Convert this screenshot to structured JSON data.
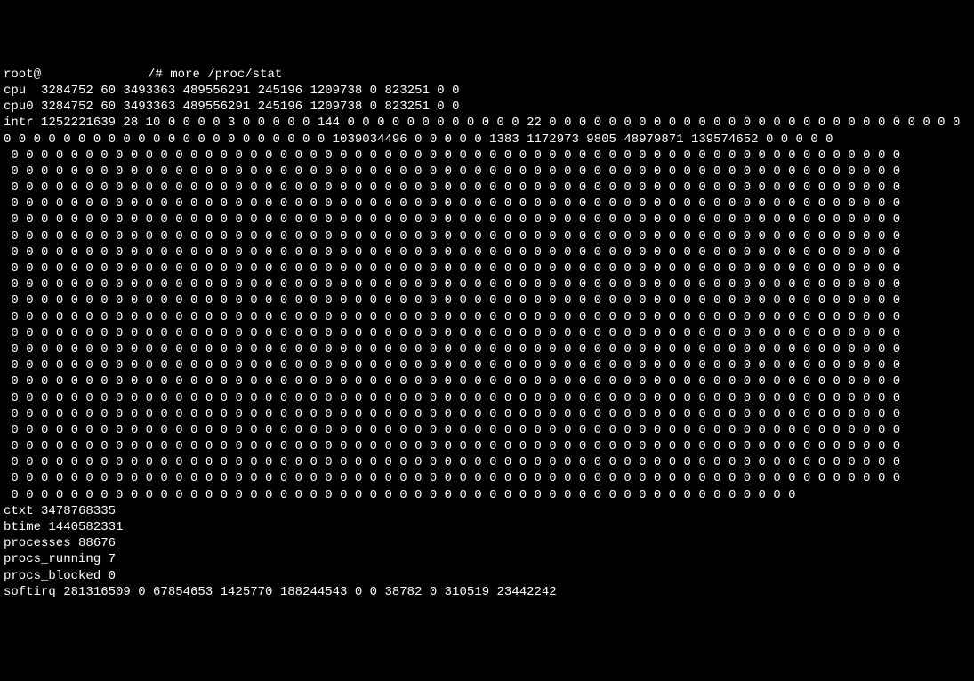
{
  "prompt": {
    "user": "root@",
    "hostname_redacted": true,
    "path_suffix": "/# ",
    "command": "more /proc/stat"
  },
  "proc_stat": {
    "cpu": "cpu  3284752 60 3493363 489556291 245196 1209738 0 823251 0 0",
    "cpu0": "cpu0 3284752 60 3493363 489556291 245196 1209738 0 823251 0 0",
    "intr_prefix": "intr 1252221639 28 10 0 0 0 0 3 0 0 0 0 0 144 0 0 0 0 0 0 0 0 0 0 0 0 22 0 0 0 0 0 0 0 0 0 0 0 0 0 0 0 0 0 0 0 0 0 0 0 0 0 0 0 0 0 0 0 0 0 0 0 0 0 0 0 0 0 0 0 0 0 0 0 0 0 0 1039034496 0 0 0 0 0 1383 1172973 9805 48979871 139574652 0 0 0 0 0",
    "zeros_line_full": "0 0 0 0 0 0 0 0 0 0 0 0 0 0 0 0 0 0 0 0 0 0 0 0 0 0 0 0 0 0 0 0 0 0 0 0 0 0 0 0 0 0 0 0 0 0 0 0 0 0 0 0 0 0 0 0 0 0 0 0",
    "zeros_line_last": "0 0 0 0 0 0 0 0 0 0 0 0 0 0 0 0 0 0 0 0 0 0 0 0 0 0 0 0 0 0 0 0 0 0 0 0 0 0 0 0 0 0 0 0 0 0 0 0 0 0 0 0 0",
    "ctxt": "ctxt 3478768335",
    "btime": "btime 1440582331",
    "processes": "processes 88676",
    "procs_running": "procs_running 7",
    "procs_blocked": "procs_blocked 0",
    "softirq": "softirq 281316509 0 67854653 1425770 188244543 0 0 38782 0 310519 23442242"
  },
  "zero_line_count": 21
}
